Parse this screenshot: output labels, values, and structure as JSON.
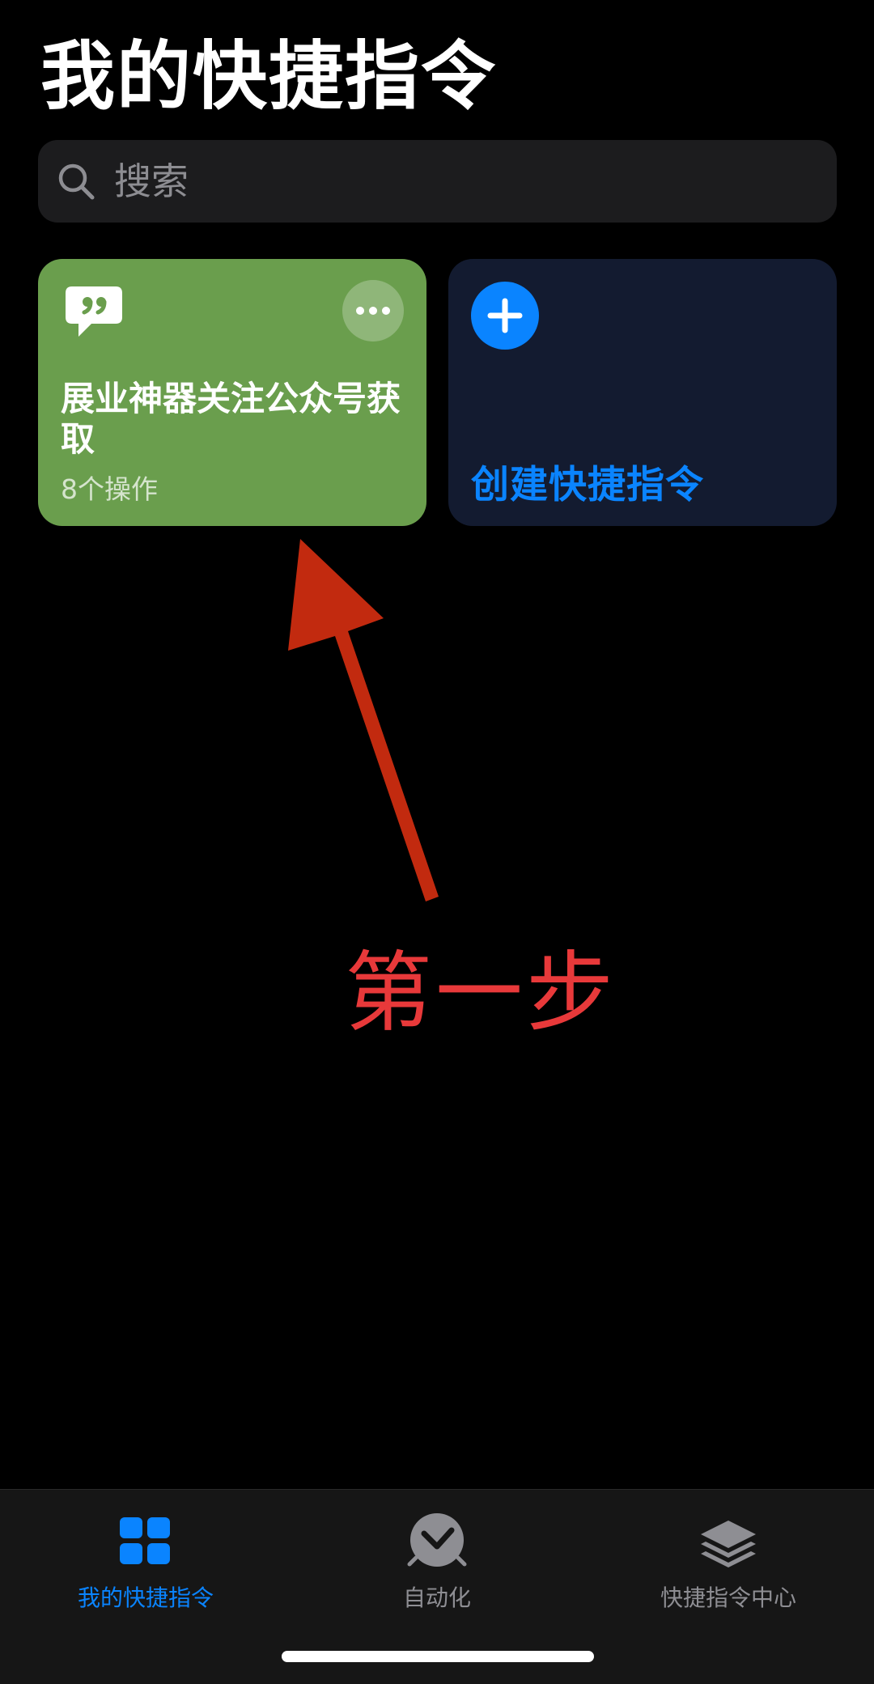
{
  "page": {
    "title": "我的快捷指令"
  },
  "search": {
    "placeholder": "搜索"
  },
  "shortcuts": [
    {
      "title": "展业神器关注公众号获取",
      "subtitle": "8个操作",
      "color": "#6a9e4d",
      "icon": "quote-bubble-icon"
    }
  ],
  "create": {
    "label": "创建快捷指令",
    "color": "#0a84ff"
  },
  "annotation": {
    "step_label": "第一步",
    "color": "#e8393a"
  },
  "tabs": [
    {
      "label": "我的快捷指令",
      "icon": "grid-icon",
      "active": true
    },
    {
      "label": "自动化",
      "icon": "clock-check-icon",
      "active": false
    },
    {
      "label": "快捷指令中心",
      "icon": "layers-icon",
      "active": false
    }
  ],
  "colors": {
    "accent": "#0a84ff",
    "background": "#000000",
    "inactive_tab": "#8e8e93"
  }
}
